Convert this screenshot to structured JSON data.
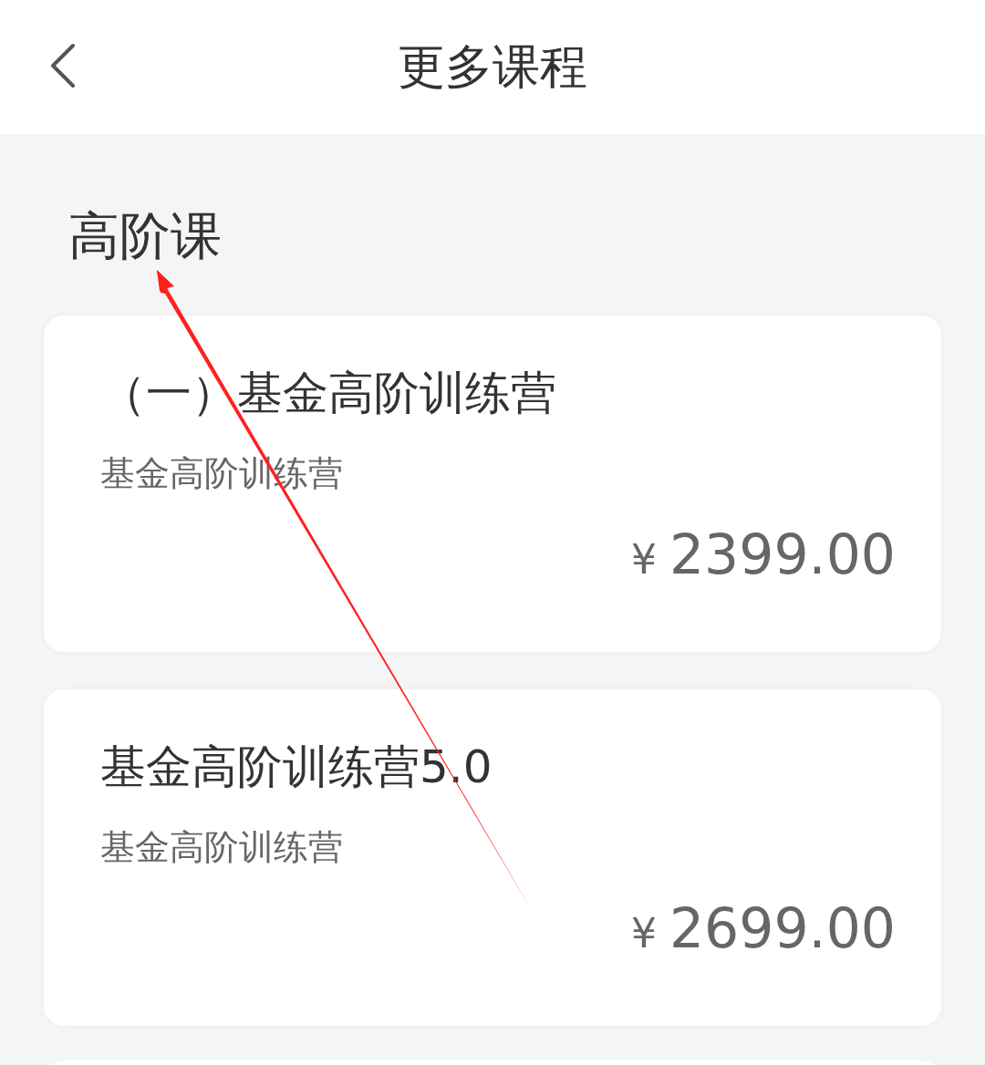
{
  "header": {
    "title": "更多课程"
  },
  "section": {
    "title": "高阶课"
  },
  "courses": [
    {
      "title": "（一）基金高阶训练营",
      "subtitle": "基金高阶训练营",
      "currency": "¥",
      "price": "2399.00"
    },
    {
      "title": "基金高阶训练营5.0",
      "subtitle": "基金高阶训练营",
      "currency": "¥",
      "price": "2699.00"
    }
  ],
  "annotation": {
    "kind": "arrow"
  }
}
